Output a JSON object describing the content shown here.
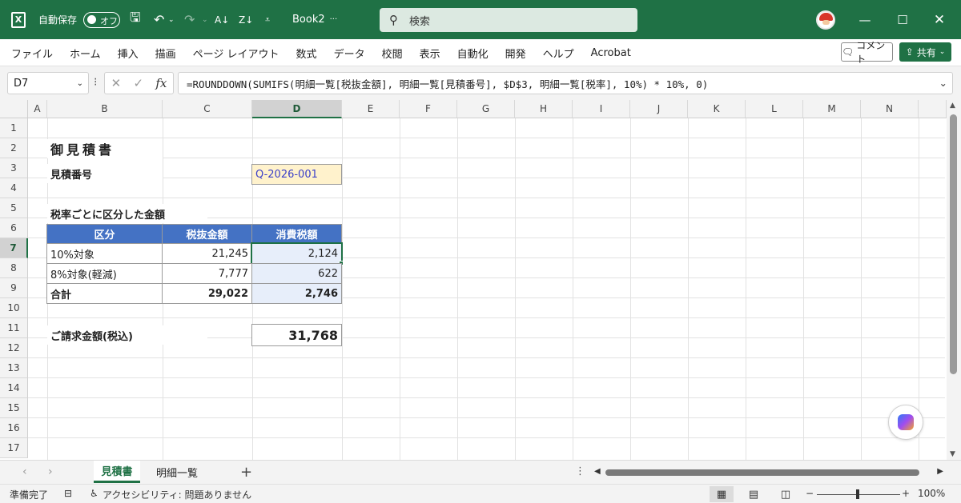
{
  "titlebar": {
    "autosave_label": "自動保存",
    "autosave_state": "オフ",
    "filename": "Book2",
    "filename_suffix": "···",
    "search_placeholder": "検索"
  },
  "ribbon": {
    "menu": [
      "ファイル",
      "ホーム",
      "挿入",
      "描画",
      "ページ レイアウト",
      "数式",
      "データ",
      "校閲",
      "表示",
      "自動化",
      "開発",
      "ヘルプ",
      "Acrobat"
    ],
    "comment_label": "コメント",
    "share_label": "共有"
  },
  "formula_bar": {
    "name_box": "D7",
    "formula": "=ROUNDDOWN(SUMIFS(明細一覧[税抜金額], 明細一覧[見積番号], $D$3, 明細一覧[税率], 10%) * 10%, 0)"
  },
  "columns": [
    "A",
    "B",
    "C",
    "D",
    "E",
    "F",
    "G",
    "H",
    "I",
    "J",
    "K",
    "L",
    "M",
    "N"
  ],
  "rows": [
    "1",
    "2",
    "3",
    "4",
    "5",
    "6",
    "7",
    "8",
    "9",
    "10",
    "11",
    "12",
    "13",
    "14",
    "15",
    "16",
    "17"
  ],
  "sheet": {
    "title": "御見積書",
    "quote_no_label": "見積番号",
    "quote_no": "Q-2026-001",
    "section_label": "税率ごとに区分した金額",
    "table_headers": [
      "区分",
      "税抜金額",
      "消費税額"
    ],
    "table_rows": [
      {
        "category": "10%対象",
        "net": "21,245",
        "tax": "2,124"
      },
      {
        "category": "8%対象(軽減)",
        "net": "7,777",
        "tax": "622"
      },
      {
        "category": "合計",
        "net": "29,022",
        "tax": "2,746"
      }
    ],
    "total_label": "ご請求金額(税込)",
    "total_value": "31,768"
  },
  "sheet_tabs": [
    "見積書",
    "明細一覧"
  ],
  "statusbar": {
    "ready": "準備完了",
    "accessibility": "アクセシビリティ: 問題ありません",
    "zoom": "100%"
  },
  "colors": {
    "excel_green": "#1f7145",
    "table_header": "#4472c4",
    "tax_column": "#e7eefa",
    "input_cell": "#fff2cc"
  }
}
